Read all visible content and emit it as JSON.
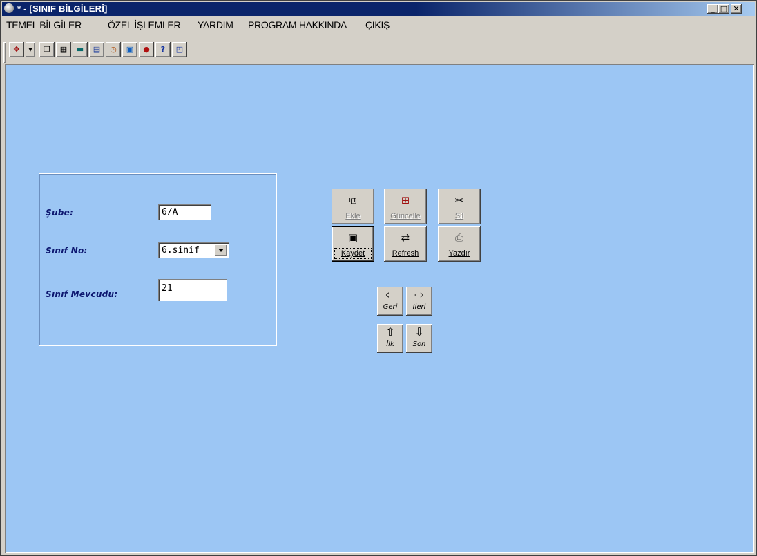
{
  "window": {
    "title": "* - [SINIF BİLGİLERİ]",
    "controls": {
      "minimize": "_",
      "maximize": "□",
      "close": "✕"
    }
  },
  "menu": [
    "TEMEL BİLGİLER",
    "ÖZEL İŞLEMLER",
    "YARDIM",
    "PROGRAM HAKKINDA",
    "ÇIKIŞ"
  ],
  "toolbar": {
    "buttons": [
      {
        "icon": "tools-icon",
        "glyph": "✥"
      },
      {
        "icon": "dropdown-icon",
        "glyph": "▾"
      },
      {
        "icon": "copy-icon",
        "glyph": "❐"
      },
      {
        "icon": "grid-icon",
        "glyph": "▦"
      },
      {
        "icon": "keyboard-icon",
        "glyph": "▬"
      },
      {
        "icon": "calendar-icon",
        "glyph": "▤"
      },
      {
        "icon": "clock-icon",
        "glyph": "◷"
      },
      {
        "icon": "image-icon",
        "glyph": "▣"
      },
      {
        "icon": "globe-icon",
        "glyph": "●"
      },
      {
        "icon": "help-icon",
        "glyph": "?"
      },
      {
        "icon": "window-icon",
        "glyph": "◰"
      }
    ]
  },
  "form": {
    "sube_label": "Şube:",
    "sube_value": "6/A",
    "sinif_no_label": "Sınıf No:",
    "sinif_no_value": "6.sinif",
    "mevcut_label": "Sınıf Mevcudu:",
    "mevcut_value": "21"
  },
  "actions": {
    "ekle": "Ekle",
    "guncelle": "Güncelle",
    "sil": "Sil",
    "kaydet": "Kaydet",
    "refresh": "Refresh",
    "yazdir": "Yazdır"
  },
  "nav": {
    "geri": "Geri",
    "ileri": "İleri",
    "ilk": "İlk",
    "son": "Son"
  }
}
